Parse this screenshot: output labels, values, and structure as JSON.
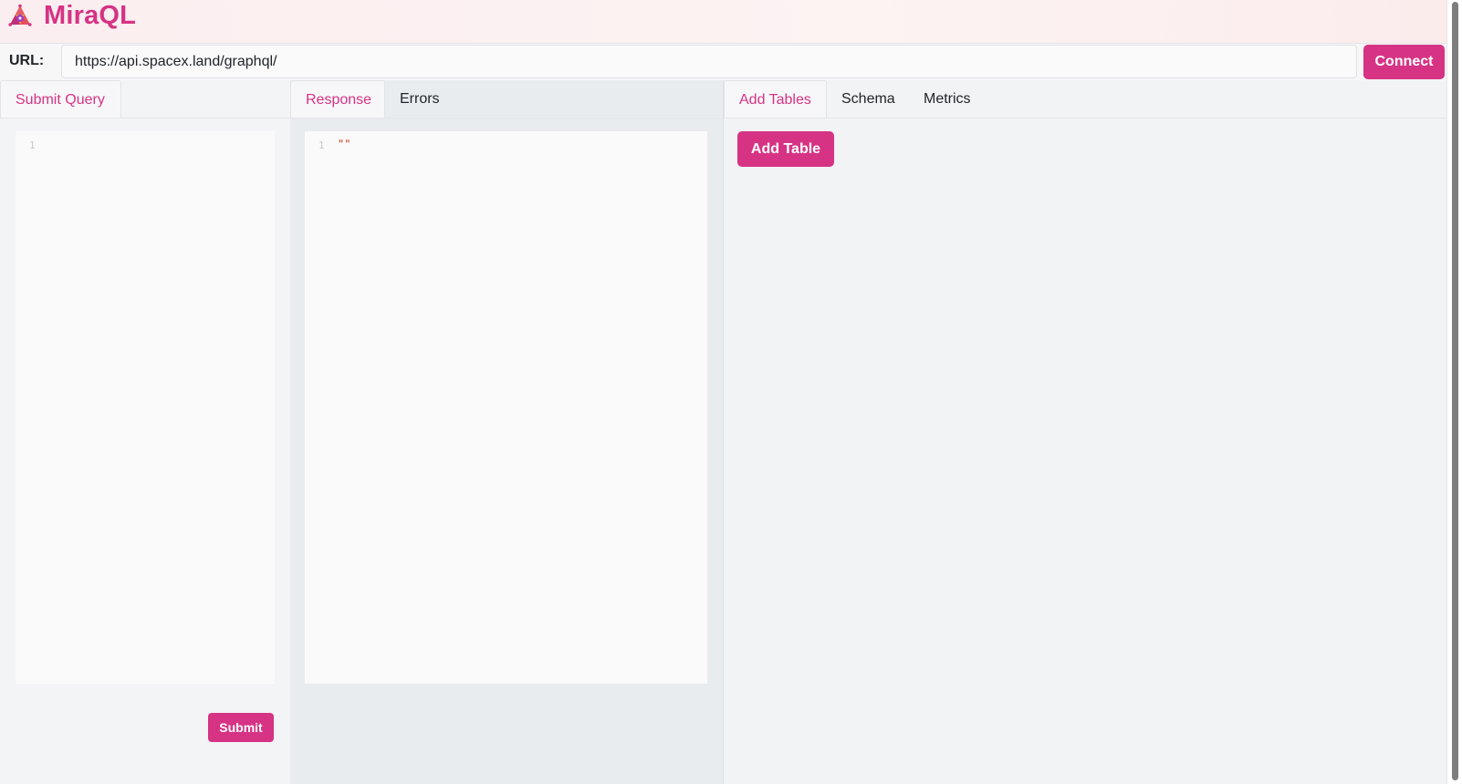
{
  "app": {
    "title": "MiraQL",
    "accent_color": "#d63384"
  },
  "url_bar": {
    "label": "URL:",
    "value": "https://api.spacex.land/graphql/",
    "connect_label": "Connect"
  },
  "query_panel": {
    "tab_label": "Submit Query",
    "line_number": "1",
    "submit_label": "Submit"
  },
  "response_panel": {
    "tabs": [
      {
        "label": "Response",
        "active": true
      },
      {
        "label": "Errors",
        "active": false
      }
    ],
    "line_number": "1",
    "content": "\"\""
  },
  "tables_panel": {
    "tabs": [
      {
        "label": "Add Tables",
        "active": true
      },
      {
        "label": "Schema",
        "active": false
      },
      {
        "label": "Metrics",
        "active": false
      }
    ],
    "add_table_label": "Add Table"
  },
  "icons": {
    "logo": "miraql-logo-icon"
  }
}
